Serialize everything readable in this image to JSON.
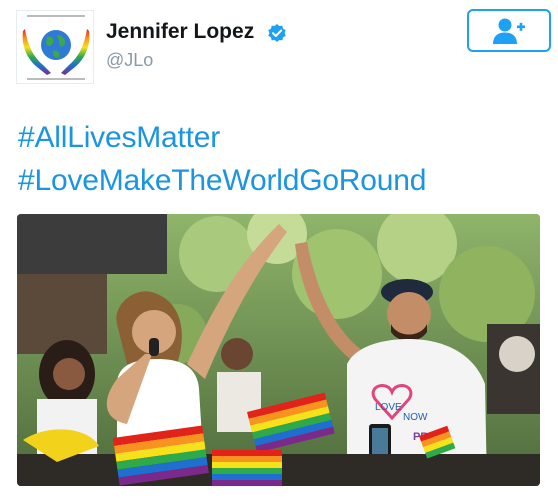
{
  "user": {
    "name": "Jennifer Lopez",
    "handle": "@JLo",
    "verified": true,
    "avatar_icon": "rainbow-globe-hands-icon"
  },
  "follow_button": {
    "icon": "add-user-icon"
  },
  "tweet": {
    "hashtags": [
      "#AllLivesMatter",
      "#LoveMakeTheWorldGoRound"
    ]
  },
  "media": {
    "shirt_text": {
      "line1": "LOVE",
      "line2": "NOW",
      "line3": "PRIDE"
    }
  },
  "colors": {
    "link_blue": "#1b95e0",
    "follow_blue": "#1da1f2",
    "name_text": "#14171a",
    "handle_text": "#8899a6"
  }
}
